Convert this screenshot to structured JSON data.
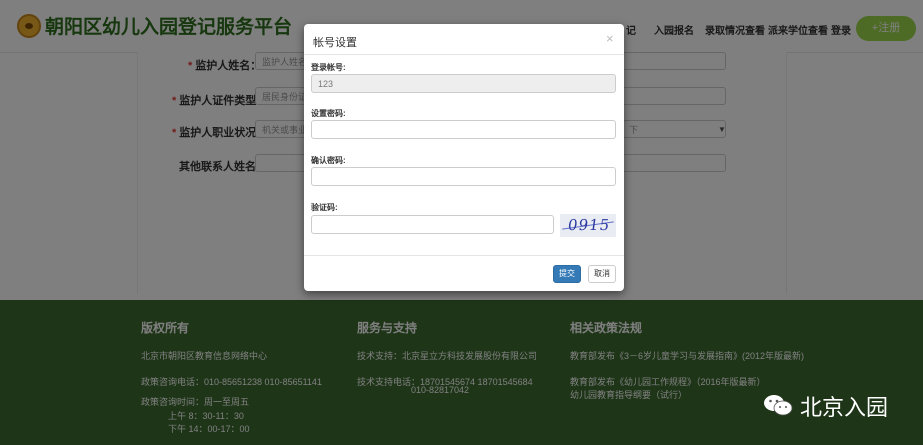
{
  "header": {
    "site_title": "朝阳区幼儿入园登记服务平台",
    "nav": [
      "记",
      "入园报名",
      "录取情况查看",
      "派来学位查看",
      "登录"
    ],
    "register_label": "+注册"
  },
  "form": {
    "guardian_name_label": "监护人姓名：",
    "guardian_name_placeholder": "监护人姓名",
    "guardian_id_type_label": "监护人证件类型：",
    "guardian_id_type_value": "居民身份证",
    "guardian_job_label": "监护人职业状况：",
    "guardian_job_value": "机关或事业单",
    "guardian_job_value_right": "下",
    "other_contact_label": "其他联系人姓名："
  },
  "footer": {
    "col1": {
      "title": "版权所有",
      "lines": [
        "北京市朝阳区教育信息网络中心",
        "政策咨询电话：010-85651238  010-85651141",
        "政策咨询时间：周一至周五",
        "上午 8：30-11：30",
        "下午 14：00-17：00"
      ]
    },
    "col2": {
      "title": "服务与支持",
      "lines": [
        "技术支持：北京星立方科技发展股份有限公司",
        "技术支持电话：18701545674  18701545684",
        "010-82817042"
      ]
    },
    "col3": {
      "title": "相关政策法规",
      "lines": [
        "教育部发布《3－6岁儿童学习与发展指南》(2012年版最新)",
        "教育部发布《幼儿园工作规程》（2016年版最新）",
        "幼儿园教育指导纲要（试行）"
      ]
    }
  },
  "watermark": {
    "text": "北京入园"
  },
  "modal": {
    "title": "帐号设置",
    "close": "×",
    "account_label": "登录帐号:",
    "account_value": "123",
    "password_label": "设置密码:",
    "confirm_label": "确认密码:",
    "captcha_label": "验证码:",
    "captcha_text": "0915",
    "submit_label": "提交",
    "cancel_label": "取消"
  }
}
